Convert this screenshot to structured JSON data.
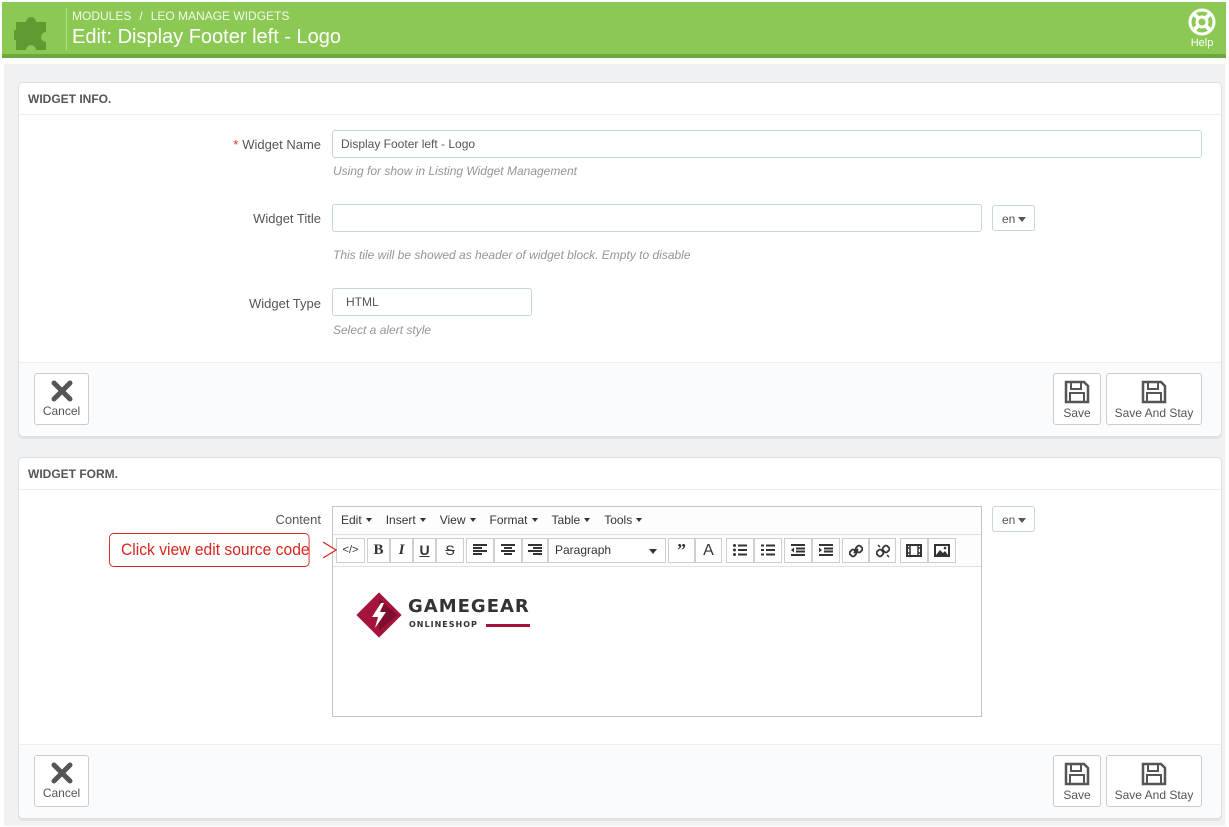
{
  "header": {
    "breadcrumb": [
      "MODULES",
      "LEO MANAGE WIDGETS"
    ],
    "breadcrumb_sep": "/",
    "title": "Edit: Display Footer left - Logo",
    "help_label": "Help"
  },
  "widget_info": {
    "heading": "WIDGET INFO.",
    "name": {
      "label": "Widget Name",
      "required_mark": "*",
      "value": "Display Footer left - Logo",
      "help": "Using for show in Listing Widget Management"
    },
    "title": {
      "label": "Widget Title",
      "value": "",
      "lang": "en",
      "help": "This tile will be showed as header of widget block. Empty to disable"
    },
    "type": {
      "label": "Widget Type",
      "value": "HTML",
      "help": "Select a alert style"
    },
    "cancel_label": "Cancel",
    "save_label": "Save",
    "save_stay_label": "Save And Stay"
  },
  "widget_form": {
    "heading": "WIDGET FORM.",
    "content_label": "Content",
    "lang": "en",
    "menu": [
      "Edit",
      "Insert",
      "View",
      "Format",
      "Table",
      "Tools"
    ],
    "block_format": "Paragraph",
    "toolbar_icons": [
      "source-code-icon",
      "bold-icon",
      "italic-icon",
      "underline-icon",
      "strikethrough-icon",
      "align-left-icon",
      "align-center-icon",
      "align-right-icon",
      "blockquote-icon",
      "text-color-icon",
      "bullet-list-icon",
      "numbered-list-icon",
      "outdent-icon",
      "indent-icon",
      "link-icon",
      "unlink-icon",
      "media-icon",
      "image-icon"
    ],
    "logo": {
      "brand": "GAMEGEAR",
      "tagline": "ONLINESHOP"
    },
    "callout": "Click view edit source code",
    "cancel_label": "Cancel",
    "save_label": "Save",
    "save_stay_label": "Save And Stay"
  },
  "colors": {
    "header_green": "#8bc954",
    "logo_red": "#a4133c",
    "callout_red": "#d9261c"
  }
}
